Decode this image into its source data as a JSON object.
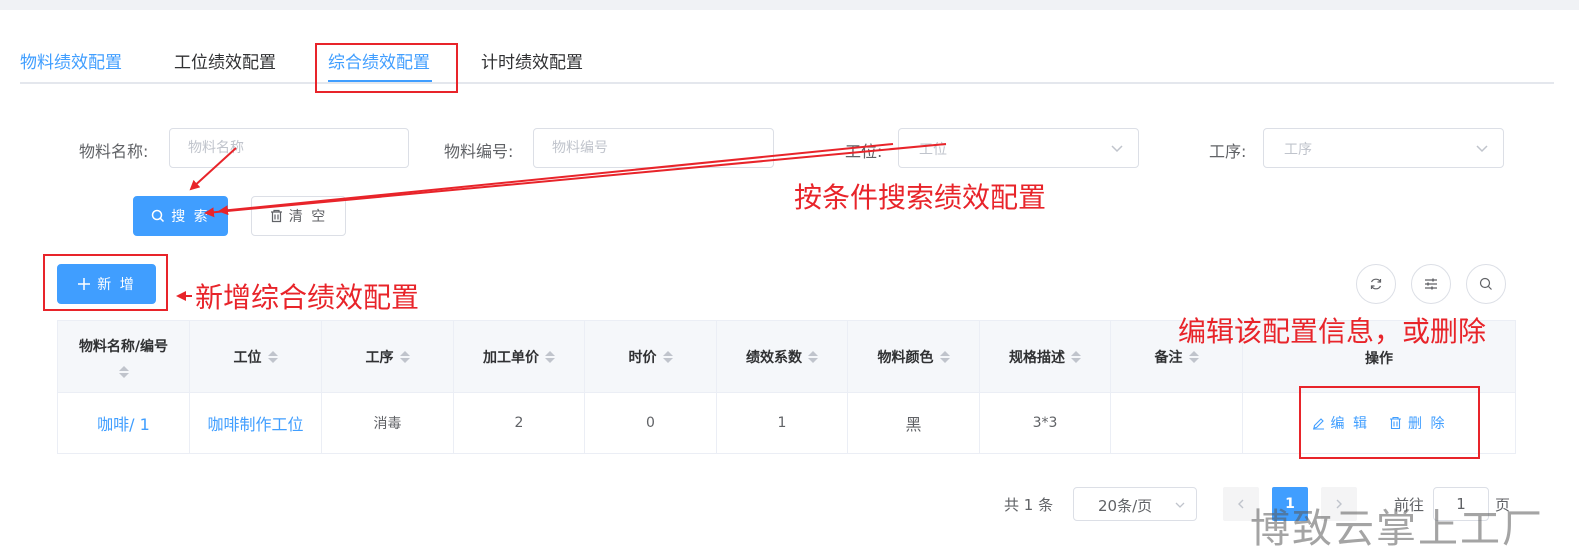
{
  "tabs": [
    {
      "label": "物料绩效配置",
      "active": false
    },
    {
      "label": "工位绩效配置",
      "active": false
    },
    {
      "label": "综合绩效配置",
      "active": true
    },
    {
      "label": "计时绩效配置",
      "active": false
    }
  ],
  "filters": {
    "material_name": {
      "label": "物料名称:",
      "placeholder": "物料名称"
    },
    "material_code": {
      "label": "物料编号:",
      "placeholder": "物料编号"
    },
    "station": {
      "label": "工位:",
      "placeholder": "工位"
    },
    "process": {
      "label": "工序:",
      "placeholder": "工序"
    }
  },
  "buttons": {
    "search": "搜 索",
    "clear": "清 空",
    "add": "新 增"
  },
  "table": {
    "columns": [
      "物料名称/编号",
      "工位",
      "工序",
      "加工单价",
      "时价",
      "绩效系数",
      "物料颜色",
      "规格描述",
      "备注",
      "操作"
    ],
    "rows": [
      {
        "material": "咖啡/ 1",
        "station": "咖啡制作工位",
        "process": "消毒",
        "unit_price": "2",
        "hourly_price": "0",
        "coefficient": "1",
        "color": "黑",
        "spec": "3*3",
        "remark": ""
      }
    ],
    "actions": {
      "edit": "编 辑",
      "delete": "删 除"
    }
  },
  "pagination": {
    "total": "共 1 条",
    "page_size": "20条/页",
    "current_page": "1",
    "goto_prefix": "前往",
    "goto_value": "1",
    "goto_suffix": "页"
  },
  "annotations": {
    "search": "按条件搜索绩效配置",
    "add": "新增综合绩效配置",
    "ops": "编辑该配置信息，或删除"
  },
  "watermark": "博致云掌上工厂",
  "colors": {
    "primary": "#409eff",
    "annotation": "#e8242a",
    "border": "#dcdfe6"
  }
}
